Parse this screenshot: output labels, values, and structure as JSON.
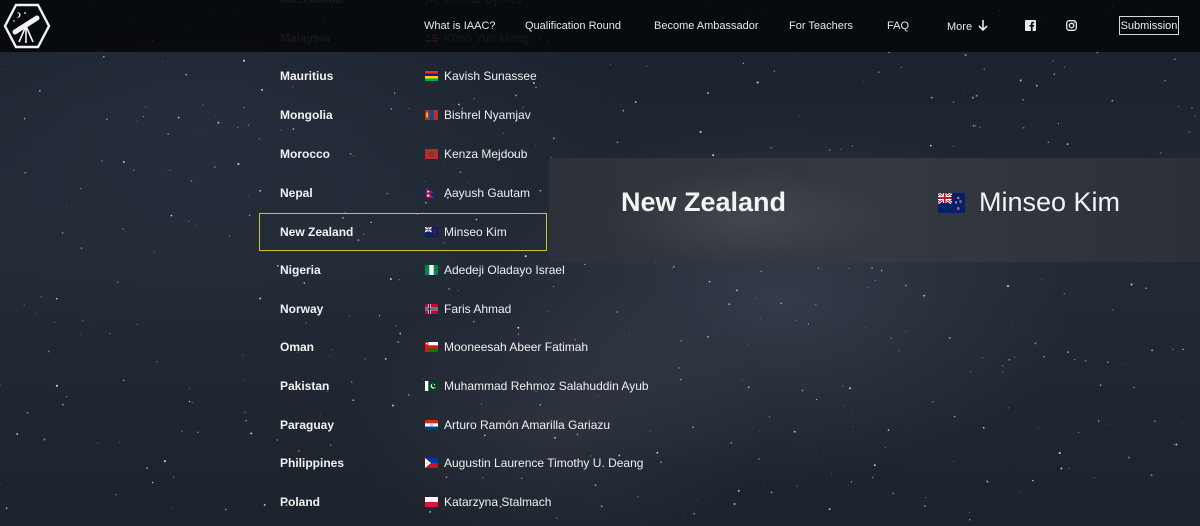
{
  "header": {
    "nav": [
      {
        "label": "What is IAAC?"
      },
      {
        "label": "Qualification Round"
      },
      {
        "label": "Become Ambassador"
      },
      {
        "label": "For Teachers"
      },
      {
        "label": "FAQ"
      },
      {
        "label": "More"
      }
    ],
    "social_icons": [
      "facebook-icon",
      "instagram-icon"
    ],
    "submit_label": "Submission"
  },
  "rows": [
    {
      "country": "Macedonia",
      "name": "Dimitar Djorlev",
      "flag": "macedonia"
    },
    {
      "country": "Malaysia",
      "name": "Khoo Yun Meng",
      "flag": "malaysia"
    },
    {
      "country": "Mauritius",
      "name": "Kavish Sunassee",
      "flag": "mauritius"
    },
    {
      "country": "Mongolia",
      "name": "Bishrel Nyamjav",
      "flag": "mongolia"
    },
    {
      "country": "Morocco",
      "name": "Kenza Mejdoub",
      "flag": "morocco"
    },
    {
      "country": "Nepal",
      "name": "Aayush Gautam",
      "flag": "nepal"
    },
    {
      "country": "New Zealand",
      "name": "Minseo Kim",
      "flag": "new-zealand"
    },
    {
      "country": "Nigeria",
      "name": "Adedeji Oladayo Israel",
      "flag": "nigeria"
    },
    {
      "country": "Norway",
      "name": "Faris Ahmad",
      "flag": "norway"
    },
    {
      "country": "Oman",
      "name": "Mooneesah Abeer Fatimah",
      "flag": "oman"
    },
    {
      "country": "Pakistan",
      "name": "Muhammad Rehmoz Salahuddin Ayub",
      "flag": "pakistan"
    },
    {
      "country": "Paraguay",
      "name": "Arturo Ramón Amarilla Gariazu",
      "flag": "paraguay"
    },
    {
      "country": "Philippines",
      "name": "Augustin Laurence Timothy U. Deang",
      "flag": "philippines"
    },
    {
      "country": "Poland",
      "name": "Katarzyna Stalmach",
      "flag": "poland"
    }
  ],
  "zoom": {
    "country": "New Zealand",
    "name": "Minseo Kim"
  }
}
